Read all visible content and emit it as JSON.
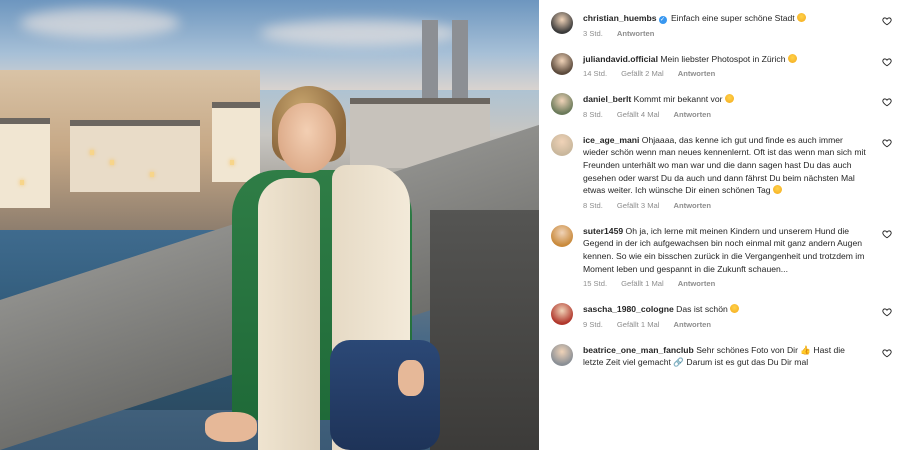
{
  "comments": [
    {
      "user": "christian_huembs",
      "verified": true,
      "text": "Einfach eine super schöne Stadt",
      "emoji": true,
      "time": "3 Std.",
      "likes": "",
      "reply": "Antworten",
      "avatar_color": "#3a3a3a"
    },
    {
      "user": "juliandavid.official",
      "verified": false,
      "text": "Mein liebster Photospot in Zürich",
      "emoji": true,
      "time": "14 Std.",
      "likes": "Gefällt 2 Mal",
      "reply": "Antworten",
      "avatar_color": "#5b4a3c"
    },
    {
      "user": "daniel_berlt",
      "verified": false,
      "text": "Kommt mir bekannt vor",
      "emoji": true,
      "time": "8 Std.",
      "likes": "Gefällt 4 Mal",
      "reply": "Antworten",
      "avatar_color": "#6b7a5a"
    },
    {
      "user": "ice_age_mani",
      "verified": false,
      "text": "Ohjaaaa, das kenne ich gut und finde es auch immer wieder schön wenn man neues kennenlernt. Oft ist das wenn man sich mit Freunden unterhält wo man war und die dann sagen hast Du das auch gesehen oder warst Du da auch und dann fährst Du beim nächsten Mal etwas weiter. Ich wünsche Dir einen schönen Tag",
      "emoji": true,
      "time": "8 Std.",
      "likes": "Gefällt 3 Mal",
      "reply": "Antworten",
      "avatar_color": "#c9b79c"
    },
    {
      "user": "suter1459",
      "verified": false,
      "text": "Oh ja, ich lerne mit meinen Kindern und unserem Hund die Gegend in der ich aufgewachsen bin noch einmal mit ganz andern Augen kennen. So wie ein bisschen zurück in die Vergangenheit und trotzdem im Moment leben und gespannt in die Zukunft schauen...",
      "emoji": false,
      "time": "15 Std.",
      "likes": "Gefällt 1 Mal",
      "reply": "Antworten",
      "avatar_color": "#c98a3c"
    },
    {
      "user": "sascha_1980_cologne",
      "verified": false,
      "text": "Das ist schön",
      "emoji": true,
      "time": "9 Std.",
      "likes": "Gefällt 1 Mal",
      "reply": "Antworten",
      "avatar_color": "#b0372c"
    },
    {
      "user": "beatrice_one_man_fanclub",
      "verified": false,
      "text": "Sehr schönes Foto von Dir 👍 Hast die letzte Zeit viel gemacht 🔗 Darum ist es gut das Du Dir mal",
      "emoji": false,
      "time": "",
      "likes": "",
      "reply": "",
      "avatar_color": "#8a8f95"
    }
  ]
}
